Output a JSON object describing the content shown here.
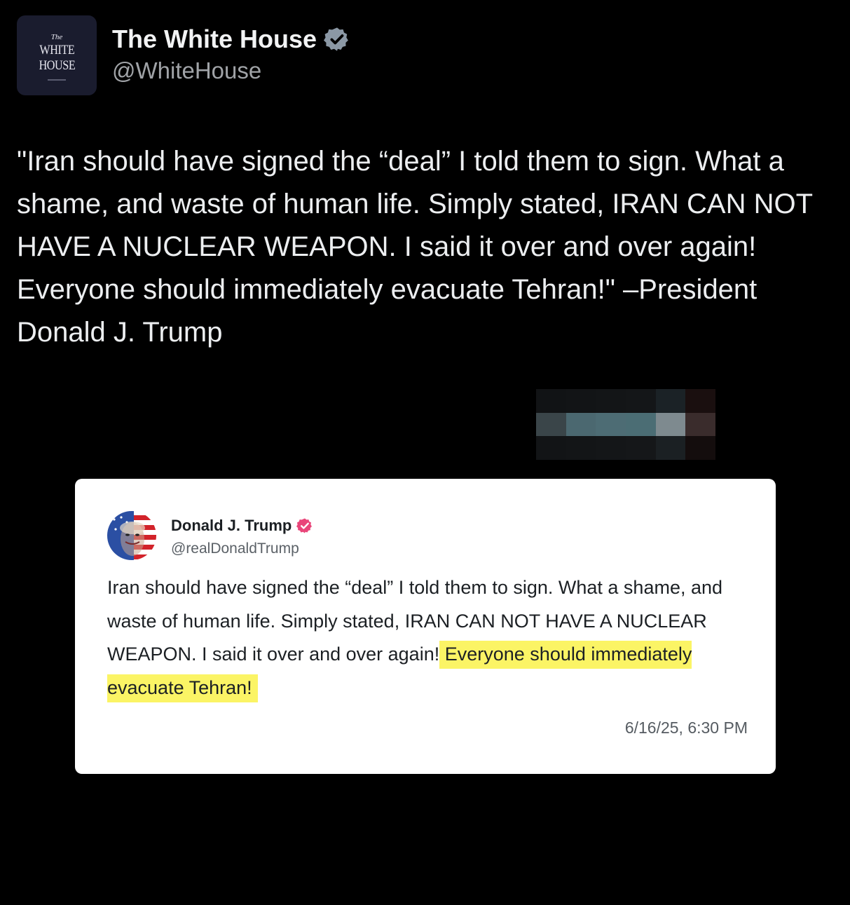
{
  "post": {
    "avatar": {
      "line1": "The",
      "line2": "WHITE",
      "line3": "HOUSE"
    },
    "display_name": "The White House",
    "handle": "@WhiteHouse",
    "badge_color": "#8b98a5",
    "text": "\"Iran should have signed the “deal” I told them to sign. What a shame, and waste of human life. Simply stated, IRAN CAN NOT HAVE A NUCLEAR WEAPON. I said it over and over again! Everyone should immediately evacuate Tehran!\" –President Donald J. Trump"
  },
  "embedded_post": {
    "display_name": "Donald J. Trump",
    "handle": "@realDonaldTrump",
    "badge_color": "#e9467a",
    "text_main": "Iran should have signed the “deal” I told them to sign. What a shame, and waste of human life. Simply stated, IRAN CAN NOT HAVE A NUCLEAR WEAPON. I said it over and over again!",
    "text_highlight": "Everyone should immediately evacuate Tehran!",
    "highlight_color": "#fbf465",
    "timestamp": "6/16/25, 6:30 PM"
  },
  "redacted_block_colors": [
    "#111315",
    "#121416",
    "#131517",
    "#141618",
    "#1b2226",
    "#1a0f0f",
    "#3a4549",
    "#4b6870",
    "#4d6c74",
    "#4b6d74",
    "#7e8a8f",
    "#3a2c2c",
    "#121416",
    "#131517",
    "#141618",
    "#151719",
    "#1b2023",
    "#140d0d"
  ]
}
